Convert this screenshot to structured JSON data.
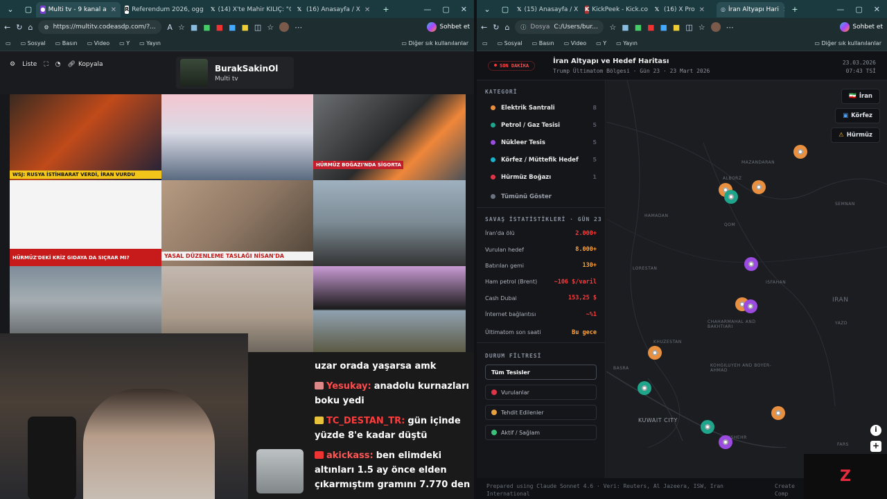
{
  "left_window": {
    "tabs": [
      {
        "label": "Multi tv - 9 kanal a",
        "active": true
      },
      {
        "label": "Referendum 2026, ogg"
      },
      {
        "label": "(14) X'te Mahir KILIÇ: \"G"
      },
      {
        "label": "(16) Anasayfa / X"
      }
    ],
    "url": "https://multitv.codeasdp.com/?...",
    "copilot_label": "Sohbet et",
    "bookmarks": [
      "Sosyal",
      "Basın",
      "Video",
      "Y",
      "Yayın"
    ],
    "bookmarks_right": "Diğer sık kullanılanlar",
    "toolbar": {
      "list": "Liste",
      "copy": "Kopyala"
    },
    "streamer": {
      "name": "BurakSakinOl",
      "sub": "Multi tv"
    },
    "tiles": [
      {
        "caption": "WSJ: RUSYA İSTİHBARAT VERDİ, İRAN VURDU"
      },
      {
        "caption": ""
      },
      {
        "caption": "HÜRMÜZ BOĞAZI'NDA SİGORTA KRİZİ"
      },
      {
        "caption": "HÜRMÜZ'DEKİ KRİZ GIDAYA DA SIÇRAR MI?"
      },
      {
        "caption": "YASAL DÜZENLEME TASLAĞI NİSAN'DA"
      },
      {
        "caption": ""
      },
      {
        "caption": ""
      },
      {
        "caption": ""
      },
      {
        "caption": ""
      }
    ],
    "chat": [
      {
        "user": "",
        "text": "uzar orada yaşarsa amk",
        "color": "#ffffff",
        "badge": ""
      },
      {
        "user": "Yesukay:",
        "text": "anadolu kurnazları boku yedi",
        "color": "#ff4b4b",
        "badge": "#d88"
      },
      {
        "user": "TC_DESTAN_TR:",
        "text": "gün içinde yüzde 8'e kadar düştü",
        "color": "#ff3b3b",
        "badge": "#e8c23a"
      },
      {
        "user": "akickass:",
        "text": "ben elimdeki altınları 1.5 ay önce elden çıkarmıştım gramını 7.770 den",
        "color": "#ff5656",
        "badge": "#e33"
      }
    ]
  },
  "right_window": {
    "tabs": [
      {
        "label": "(15) Anasayfa / X"
      },
      {
        "label": "KickPeek - Kick.co"
      },
      {
        "label": "(16) X Pro"
      },
      {
        "label": "İran Altyapı Hari",
        "active": true
      }
    ],
    "url_prefix": "Dosya",
    "url": "C:/Users/bur...",
    "copilot_label": "Sohbet et",
    "bookmarks": [
      "Sosyal",
      "Basın",
      "Video",
      "Y",
      "Yayın"
    ],
    "bookmarks_right": "Diğer sık kullanılanlar",
    "header": {
      "badge": "SON DAKİKA",
      "title": "İran Altyapı ve Hedef Haritası",
      "subtitle": "Trump Ültimatom Bölgesi · Gün 23 · 23 Mart 2026",
      "date": "23.03.2026",
      "time": "07:43 TSİ"
    },
    "category_title": "KATEGORİ",
    "categories": [
      {
        "label": "Elektrik Santrali",
        "count": "8",
        "color": "#e8903f"
      },
      {
        "label": "Petrol / Gaz Tesisi",
        "count": "5",
        "color": "#1fa58b"
      },
      {
        "label": "Nükleer Tesis",
        "count": "5",
        "color": "#9b4be0"
      },
      {
        "label": "Körfez / Müttefik Hedef",
        "count": "5",
        "color": "#19b2c8"
      },
      {
        "label": "Hürmüz Boğazı",
        "count": "1",
        "color": "#e0344b"
      },
      {
        "label": "Tümünü Göster",
        "count": "",
        "color": "#6b7280"
      }
    ],
    "stats_title": "SAVAŞ İSTATİSTİKLERİ · GÜN 23",
    "stats": [
      {
        "label": "İran'da ölü",
        "value": "2.000+",
        "color": "#ff3b3b"
      },
      {
        "label": "Vurulan hedef",
        "value": "8.000+",
        "color": "#ffa43b"
      },
      {
        "label": "Batırılan gemi",
        "value": "130+",
        "color": "#ffa43b"
      },
      {
        "label": "Ham petrol (Brent)",
        "value": "~106 $/varil",
        "color": "#ff3b3b"
      },
      {
        "label": "Cash Dubai",
        "value": "153,25 $",
        "color": "#ff3b3b"
      },
      {
        "label": "İnternet bağlantısı",
        "value": "~%1",
        "color": "#ff3b3b"
      },
      {
        "label": "Ültimatom son saati",
        "value": "Bu gece",
        "color": "#ffa43b"
      }
    ],
    "filter_title": "DURUM FİLTRESİ",
    "filters": [
      {
        "label": "Tüm Tesisler",
        "color": "",
        "active": true
      },
      {
        "label": "Vurulanlar",
        "color": "#e0344b"
      },
      {
        "label": "Tehdit Edilenler",
        "color": "#e8a13f"
      },
      {
        "label": "Aktif / Sağlam",
        "color": "#3ac27a"
      }
    ],
    "map_buttons": [
      "İran",
      "Körfez",
      "Hürmüz"
    ],
    "map_labels": [
      "MAZANDARAN",
      "SEMNAN",
      "ALBORZ",
      "QOM",
      "HAMADAN",
      "LORESTAN",
      "ISFAHAN",
      "IRAN",
      "YAZD",
      "CHAHARMAHAL AND BAKHTIARI",
      "KHUZESTAN",
      "KOHGILUYEH AND BOYER-AHMAD",
      "KUWAIT CITY",
      "BUSHEHR",
      "FARS",
      "BASRA"
    ],
    "footer": "Prepared using Claude Sonnet 4.6 · Veri: Reuters, Al Jazeera, ISW, Iran International",
    "footer_right": "Create Comp"
  }
}
